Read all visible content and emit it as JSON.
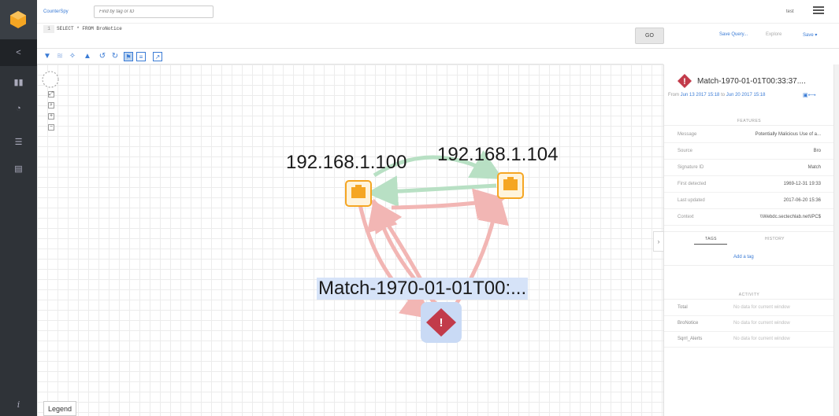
{
  "app": {
    "name": "CounterSpy",
    "search_placeholder": "Find by tag or ID",
    "user": "test"
  },
  "query": {
    "line_number": "1",
    "text": "SELECT * FROM BroNotice"
  },
  "query_actions": {
    "go": "GO",
    "save_query": "Save Query...",
    "explore": "Explore",
    "save": "Save ▾"
  },
  "graph": {
    "nodes": [
      {
        "label": "192.168.1.100",
        "type": "host",
        "icon": "ethernet-port-icon"
      },
      {
        "label": "192.168.1.104",
        "type": "host",
        "icon": "ethernet-port-icon"
      },
      {
        "label": "Match-1970-01-01T00:...",
        "type": "alert",
        "icon": "alert-diamond-icon"
      }
    ],
    "edge_colors": {
      "green": "#b8e0c4",
      "red": "#f2b6b4"
    },
    "legend": "Legend"
  },
  "panel": {
    "title": "Match-1970-01-01T00:33:37....",
    "range_from_label": "From",
    "range_from": "Jun 13 2017 15:18",
    "range_to_label": "to",
    "range_to": "Jun 20 2017 15:18",
    "features_header": "FEATURES",
    "features": [
      {
        "key": "Message",
        "value": "Potentially Malicious Use of a..."
      },
      {
        "key": "Source",
        "value": "Bro"
      },
      {
        "key": "Signature ID",
        "value": "Match"
      },
      {
        "key": "First detected",
        "value": "1969-12-31 19:33"
      },
      {
        "key": "Last updated",
        "value": "2017-06-20 15:36"
      },
      {
        "key": "Context",
        "value": "\\\\Webdc.sectechlab.net\\IPC$"
      }
    ],
    "tabs": {
      "tags": "TAGS",
      "history": "HISTORY"
    },
    "add_tag": "Add a tag",
    "activity_header": "ACTIVITY",
    "activity": [
      {
        "key": "Total",
        "value": "No data for current window"
      },
      {
        "key": "BroNotice",
        "value": "No data for current window"
      },
      {
        "key": "Sqrrl_Alerts",
        "value": "No data for current window"
      }
    ]
  },
  "colors": {
    "accent": "#3a7bd5",
    "alert": "#c23b4a",
    "host": "#f5a623"
  }
}
